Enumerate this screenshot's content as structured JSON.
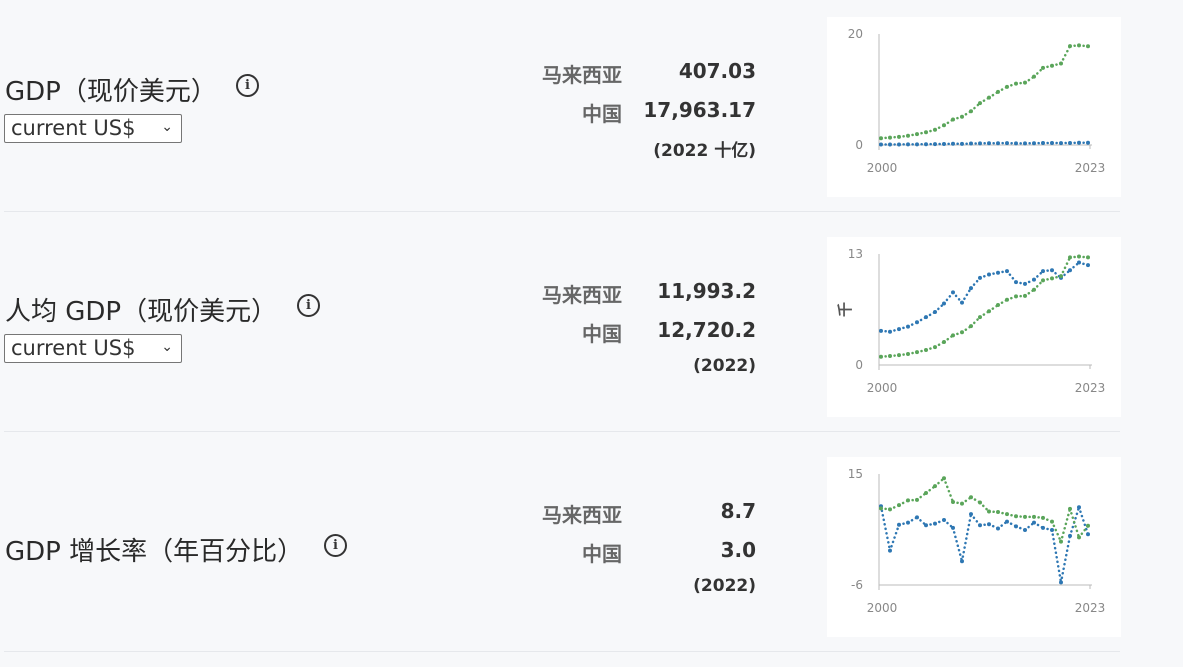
{
  "rows": [
    {
      "title": "GDP（现价美元）",
      "unit_select": "current US$",
      "countries": [
        {
          "name": "马来西亚",
          "value": "407.03"
        },
        {
          "name": "中国",
          "value": "17,963.17"
        }
      ],
      "note": "(2022 十亿)"
    },
    {
      "title": "人均 GDP（现价美元）",
      "unit_select": "current US$",
      "countries": [
        {
          "name": "马来西亚",
          "value": "11,993.2"
        },
        {
          "name": "中国",
          "value": "12,720.2"
        }
      ],
      "note": "(2022)"
    },
    {
      "title": "GDP 增长率（年百分比）",
      "countries": [
        {
          "name": "马来西亚",
          "value": "8.7"
        },
        {
          "name": "中国",
          "value": "3.0"
        }
      ],
      "note": "(2022)"
    }
  ],
  "colors": {
    "malaysia": "#2e77b3",
    "china": "#5aa55a"
  },
  "chart_data": [
    {
      "type": "line",
      "x_start": 2000,
      "x_end": 2023,
      "xticks": [
        "2000",
        "2023"
      ],
      "yticks": [
        "0",
        "20"
      ],
      "ylim": [
        0,
        20
      ],
      "ylabel": "",
      "series": [
        {
          "key": "malaysia",
          "values": [
            0.09,
            0.09,
            0.1,
            0.11,
            0.12,
            0.14,
            0.16,
            0.19,
            0.23,
            0.2,
            0.26,
            0.3,
            0.31,
            0.32,
            0.34,
            0.3,
            0.3,
            0.32,
            0.36,
            0.37,
            0.34,
            0.37,
            0.41,
            0.4
          ]
        },
        {
          "key": "china",
          "values": [
            1.21,
            1.34,
            1.47,
            1.66,
            1.96,
            2.29,
            2.75,
            3.55,
            4.59,
            5.1,
            6.09,
            7.55,
            8.53,
            9.57,
            10.48,
            11.06,
            11.23,
            12.31,
            13.89,
            14.28,
            14.69,
            17.82,
            17.96,
            17.79
          ]
        }
      ]
    },
    {
      "type": "line",
      "x_start": 2000,
      "x_end": 2023,
      "xticks": [
        "2000",
        "2023"
      ],
      "yticks": [
        "0",
        "13"
      ],
      "ylim": [
        0,
        13
      ],
      "ylabel": "千",
      "series": [
        {
          "key": "malaysia",
          "values": [
            4.0,
            3.9,
            4.2,
            4.5,
            5.0,
            5.6,
            6.2,
            7.2,
            8.5,
            7.3,
            9.0,
            10.2,
            10.6,
            10.8,
            11.0,
            9.7,
            9.5,
            10.0,
            11.0,
            11.1,
            10.2,
            11.1,
            12.0,
            11.7
          ]
        },
        {
          "key": "china",
          "values": [
            0.96,
            1.05,
            1.15,
            1.29,
            1.51,
            1.75,
            2.1,
            2.7,
            3.47,
            3.83,
            4.55,
            5.61,
            6.3,
            7.02,
            7.64,
            8.03,
            8.09,
            8.82,
            9.91,
            10.14,
            10.41,
            12.6,
            12.7,
            12.6
          ]
        }
      ]
    },
    {
      "type": "line",
      "x_start": 2000,
      "x_end": 2023,
      "xticks": [
        "2000",
        "2023"
      ],
      "yticks": [
        "-6",
        "15"
      ],
      "ylim": [
        -6,
        15
      ],
      "ylabel": "",
      "series": [
        {
          "key": "malaysia",
          "values": [
            8.9,
            0.5,
            5.4,
            5.8,
            6.8,
            5.3,
            5.6,
            6.3,
            4.8,
            -1.5,
            7.4,
            5.3,
            5.5,
            4.7,
            6.0,
            5.1,
            4.4,
            5.8,
            4.8,
            4.4,
            -5.5,
            3.3,
            8.7,
            3.6
          ]
        },
        {
          "key": "china",
          "values": [
            8.5,
            8.3,
            9.1,
            10.0,
            10.1,
            11.4,
            12.7,
            14.2,
            9.7,
            9.4,
            10.6,
            9.6,
            7.9,
            7.8,
            7.4,
            7.0,
            6.9,
            6.9,
            6.7,
            6.0,
            2.2,
            8.4,
            3.0,
            5.2
          ]
        }
      ]
    }
  ]
}
